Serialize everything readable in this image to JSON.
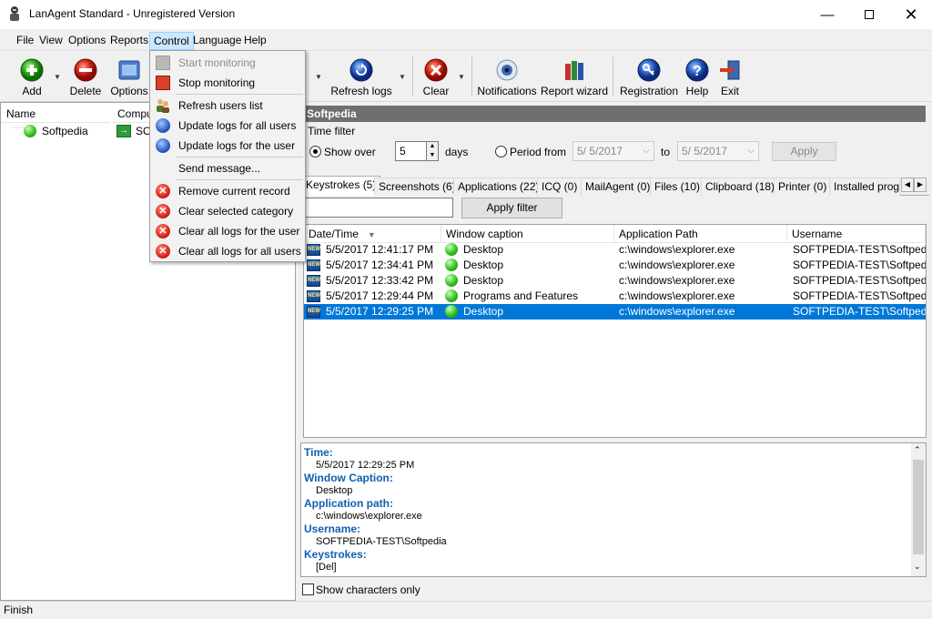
{
  "window": {
    "title": "LanAgent Standard - Unregistered Version"
  },
  "menu": [
    "File",
    "View",
    "Options",
    "Reports",
    "Control",
    "Language",
    "Help"
  ],
  "toolbar": {
    "add": "Add",
    "delete": "Delete",
    "options": "Options",
    "refresh_logs": "Refresh logs",
    "clear": "Clear",
    "notifications": "Notifications",
    "report_wizard": "Report wizard",
    "registration": "Registration",
    "help": "Help",
    "exit": "Exit"
  },
  "control_menu": {
    "start_monitoring": "Start monitoring",
    "stop_monitoring": "Stop monitoring",
    "refresh_users_list": "Refresh users list",
    "update_logs_all": "Update logs for all users",
    "update_logs_user": "Update logs for the user",
    "send_message": "Send message...",
    "remove_record": "Remove current record",
    "clear_category": "Clear selected category",
    "clear_logs_user": "Clear all logs for the user",
    "clear_logs_all": "Clear all logs for all users"
  },
  "users_panel": {
    "col_name": "Name",
    "col_computer": "Compu",
    "user_name": "Softpedia",
    "user_computer": "SOF"
  },
  "panel_title": "Softpedia",
  "time_filter": {
    "group_label": "Time filter",
    "show_over_label": "Show over",
    "days_value": "5",
    "days_label": "days",
    "period_label": "Period from",
    "from_date": "5/  5/2017",
    "to_label": "to",
    "to_date": "5/  5/2017",
    "apply": "Apply"
  },
  "tabs": [
    "Keystrokes (5)",
    "Screenshots (6)",
    "Applications (22)",
    "ICQ (0)",
    "MailAgent (0)",
    "Files (10)",
    "Clipboard (18)",
    "Printer (0)",
    "Installed progra"
  ],
  "filter": {
    "value": "",
    "apply_filter": "Apply filter"
  },
  "grid": {
    "columns": [
      "Date/Time",
      "Window caption",
      "Application Path",
      "Username"
    ],
    "new_badge": "NEW",
    "rows": [
      {
        "date": "5/5/2017 12:41:17 PM",
        "caption": "Desktop",
        "path": "c:\\windows\\explorer.exe",
        "user": "SOFTPEDIA-TEST\\Softpedia"
      },
      {
        "date": "5/5/2017 12:34:41 PM",
        "caption": "Desktop",
        "path": "c:\\windows\\explorer.exe",
        "user": "SOFTPEDIA-TEST\\Softpedia"
      },
      {
        "date": "5/5/2017 12:33:42 PM",
        "caption": "Desktop",
        "path": "c:\\windows\\explorer.exe",
        "user": "SOFTPEDIA-TEST\\Softpedia"
      },
      {
        "date": "5/5/2017 12:29:44 PM",
        "caption": "Programs and Features",
        "path": "c:\\windows\\explorer.exe",
        "user": "SOFTPEDIA-TEST\\Softpedia"
      },
      {
        "date": "5/5/2017 12:29:25 PM",
        "caption": "Desktop",
        "path": "c:\\windows\\explorer.exe",
        "user": "SOFTPEDIA-TEST\\Softpedia"
      }
    ]
  },
  "details": {
    "time_label": "Time:",
    "time_value": "5/5/2017 12:29:25 PM",
    "caption_label": "Window Caption:",
    "caption_value": "Desktop",
    "path_label": "Application path:",
    "path_value": "c:\\windows\\explorer.exe",
    "user_label": "Username:",
    "user_value": "SOFTPEDIA-TEST\\Softpedia",
    "keys_label": "Keystrokes:",
    "keys_value": "[Del]"
  },
  "show_chars_only": "Show characters only",
  "status": "Finish"
}
